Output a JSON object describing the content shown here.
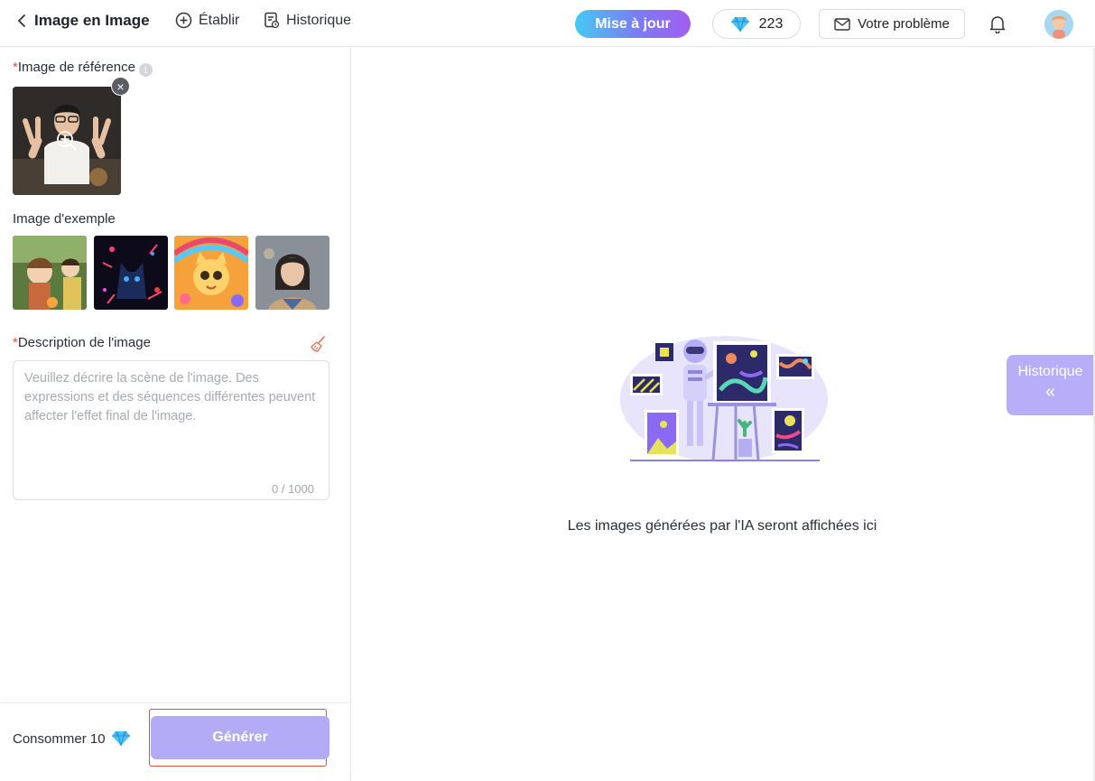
{
  "header": {
    "title": "Image en Image",
    "nav": [
      {
        "label": "Établir",
        "icon": "plus-circle-icon"
      },
      {
        "label": "Historique",
        "icon": "history-doc-icon"
      }
    ],
    "upgrade_label": "Mise à jour",
    "gems_count": "223",
    "problem_label": "Votre problème"
  },
  "left_panel": {
    "reference_label": "Image de référence",
    "required_mark": "*",
    "info_glyph": "i",
    "remove_glyph": "×",
    "example_label": "Image d'exemple",
    "examples": [
      "anime-camping-scene",
      "neon-cat-art",
      "cartoon-cat-rainbow",
      "realistic-woman-portrait"
    ],
    "description_label": "Description de l'image",
    "description_placeholder": "Veuillez décrire la scène de l'image. Des expressions et des séquences différentes peuvent affecter l'effet final de l'image.",
    "description_value": "",
    "char_counter": "0 / 1000",
    "consume_label": "Consommer 10",
    "generate_label": "Générer"
  },
  "main": {
    "empty_message": "Les images générées par l'IA seront affichées ici",
    "history_tab_label": "Historique",
    "history_tab_chevron": "«"
  },
  "colors": {
    "accent": "#b4abf7",
    "history_tab": "#b8adf8",
    "required": "#e8513a",
    "highlight_outline": "#e04b3c",
    "gem": "#3fb6f0"
  }
}
